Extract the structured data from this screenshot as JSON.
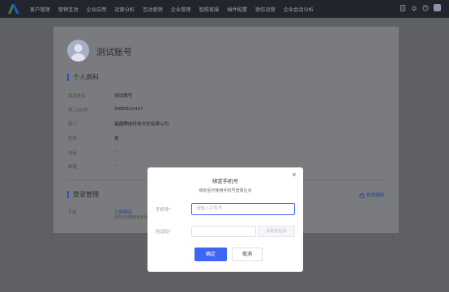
{
  "topbar": {
    "menu": [
      "客户管理",
      "营销互动",
      "企业应用",
      "运营分析",
      "互动营销",
      "企业管理",
      "智能客服",
      "插件配置",
      "微信运营",
      "企业会话分析"
    ]
  },
  "profile": {
    "name": "测试账号",
    "section_title": "个人资料",
    "fields": [
      {
        "label": "真实姓名",
        "value": "测试账号"
      },
      {
        "label": "员工QQ号",
        "value": "2985822417"
      },
      {
        "label": "部门",
        "value": "福建腾信科技文化有限公司"
      },
      {
        "label": "性别",
        "value": "男"
      },
      {
        "label": "电话",
        "value": "-"
      },
      {
        "label": "邮箱",
        "value": "-"
      }
    ]
  },
  "login": {
    "section_title": "登录管理",
    "edit_password": "修改密码",
    "phone_label": "手机",
    "bind_link": "立即绑定",
    "bind_hint": "绑定后可使用手机号"
  },
  "modal": {
    "title": "绑定手机号",
    "subtitle": "绑定后可使用手机号登录企点",
    "phone_label": "手机号*",
    "phone_placeholder": "请输入手机号",
    "code_label": "验证码*",
    "get_code": "获取验证码",
    "confirm": "确定",
    "cancel": "取消",
    "close": "×"
  },
  "colors": {
    "primary": "#3e65f4",
    "topbar": "#22252d",
    "link": "#1e3f9a"
  }
}
